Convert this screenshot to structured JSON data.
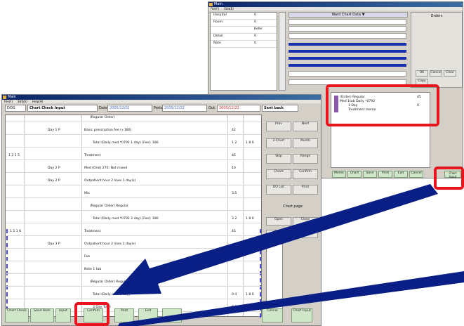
{
  "back_window": {
    "title": "Main",
    "menu": [
      "File(F)",
      "Edit(E)"
    ],
    "header_label": "Ward Chart Data ▼",
    "tree_rows": [
      {
        "label": "Hospital",
        "value": "0"
      },
      {
        "label": "Room",
        "value": "0"
      },
      {
        "label": "",
        "value": "Refer"
      },
      {
        "label": "Detail",
        "value": "0"
      },
      {
        "label": "Note",
        "value": "0"
      }
    ],
    "right_label": "Orders",
    "side_buttons": [
      "OK",
      "Cancel",
      "Clear",
      "Copy"
    ],
    "order_lines": [
      "(Order) Regular",
      "Med 1tab Daily *0792",
      "1 Day",
      "Treatment memo"
    ],
    "order_values": [
      "45",
      "0"
    ],
    "bottom_buttons": [
      "Memo",
      "Chart",
      "Save",
      "Print",
      "Exit",
      "Cancel",
      "Chart Input"
    ],
    "highlighted_button": "Chart Input"
  },
  "front_window": {
    "title": "Main",
    "menu": [
      "File(F)",
      "Edit(E)",
      "Help(H)"
    ],
    "tab_label": "DOG",
    "mode_label": "Chart Check Input",
    "date_label_1": "Date",
    "date_1": "2005/12/01",
    "date_label_2": "Period",
    "date_2": "2005/12/22",
    "date_label_3": "Out",
    "date_3": "2005/12/22",
    "status": "Sent back",
    "rows": [
      {
        "col1": "",
        "col2": "",
        "col3": "(Regular Order)",
        "col4": "",
        "col5": ""
      },
      {
        "col1": "",
        "col2": "Day 1 P",
        "col3": "Basic prescription fee (+180)",
        "col4": "42",
        "col5": ""
      },
      {
        "col1": "",
        "col2": "",
        "col3": "Total (Daily med *0792 1 day) [Fee]: 180",
        "col4": "1 2",
        "col5": "1 8 0"
      },
      {
        "col1": "1 2 1 5",
        "col2": "",
        "col3": "Treatment",
        "col4": "45",
        "col5": ""
      },
      {
        "col1": "",
        "col2": "Day 2 P",
        "col3": "Med (Oral) 270: Not mixed",
        "col4": "10",
        "col5": ""
      },
      {
        "col1": "",
        "col2": "Day 2 P",
        "col3": "Outpatient hour 2 lines 1 day(s)",
        "col4": "",
        "col5": ""
      },
      {
        "col1": "",
        "col2": "",
        "col3": "Mix",
        "col4": "3.5",
        "col5": ""
      },
      {
        "col1": "",
        "col2": "",
        "col3": "(Regular Order) Regular",
        "col4": "",
        "col5": ""
      },
      {
        "col1": "",
        "col2": "",
        "col3": "Total (Daily med *0792 2 day) [Fee]: 180",
        "col4": "3 2",
        "col5": "1 8 0"
      },
      {
        "col1": "1 2 1 6",
        "col2": "",
        "col3": "Treatment",
        "col4": "45",
        "col5": ""
      },
      {
        "col1": "",
        "col2": "Day 3 P",
        "col3": "Outpatient hour 2 lines 1 day(s)",
        "col4": "",
        "col5": ""
      },
      {
        "col1": "",
        "col2": "",
        "col3": "Fee",
        "col4": "0.5",
        "col5": ""
      },
      {
        "col1": "",
        "col2": "",
        "col3": "Note 1 tab",
        "col4": "",
        "col5": ""
      },
      {
        "col1": "",
        "col2": "",
        "col3": "(Regular Order) Regular",
        "col4": "",
        "col5": ""
      },
      {
        "col1": "",
        "col2": "",
        "col3": "Total (Daily med 2 day)",
        "col4": "0 4",
        "col5": "1 8 0"
      },
      {
        "col1": "",
        "col2": "",
        "col3": "3 Day Total",
        "col4": "0 3",
        "col5": "1 8 0"
      }
    ],
    "right_buttons": [
      [
        "Prev",
        "Next"
      ],
      [
        "2-Chart",
        "Month"
      ],
      [
        "Skip",
        "Range"
      ],
      [
        "Check",
        "Confirm"
      ],
      [
        "DO List",
        "Print"
      ]
    ],
    "right_note": "Chart page",
    "right_buttons_2": [
      "Open",
      "Close",
      "Chart",
      "Memo"
    ],
    "bottom_buttons": [
      "Chart Check",
      "Send Back",
      "Input",
      "Confirm",
      "Print",
      "Exit",
      "",
      "Cancel",
      "Chart Input"
    ],
    "highlighted_button": "Confirm"
  },
  "colors": {
    "highlight": "#e8141e",
    "arrow": "#0a1f86",
    "title_start": "#0a246a",
    "title_end": "#3a6ea5"
  }
}
